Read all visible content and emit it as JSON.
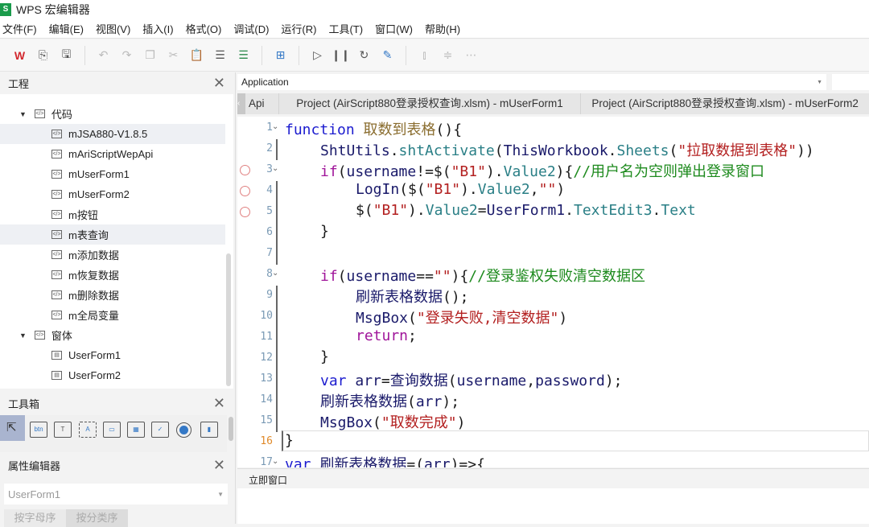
{
  "window": {
    "title": "WPS 宏编辑器",
    "logo": "S"
  },
  "menu": [
    "文件(F)",
    "编辑(E)",
    "视图(V)",
    "插入(I)",
    "格式(O)",
    "调试(D)",
    "运行(R)",
    "工具(T)",
    "窗口(W)",
    "帮助(H)"
  ],
  "project": {
    "title": "工程",
    "nodes": [
      {
        "label": "代码",
        "level": 0,
        "type": "folder",
        "expanded": true
      },
      {
        "label": "mJSA880-V1.8.5",
        "level": 1,
        "type": "module",
        "selected": true
      },
      {
        "label": "mAriScriptWepApi",
        "level": 1,
        "type": "module"
      },
      {
        "label": "mUserForm1",
        "level": 1,
        "type": "module"
      },
      {
        "label": "mUserForm2",
        "level": 1,
        "type": "module"
      },
      {
        "label": "m按钮",
        "level": 1,
        "type": "module"
      },
      {
        "label": "m表查询",
        "level": 1,
        "type": "module",
        "selected": true
      },
      {
        "label": "m添加数据",
        "level": 1,
        "type": "module"
      },
      {
        "label": "m恢复数据",
        "level": 1,
        "type": "module"
      },
      {
        "label": "m删除数据",
        "level": 1,
        "type": "module"
      },
      {
        "label": "m全局变量",
        "level": 1,
        "type": "module"
      },
      {
        "label": "窗体",
        "level": 0,
        "type": "folder",
        "expanded": true
      },
      {
        "label": "UserForm1",
        "level": 1,
        "type": "form"
      },
      {
        "label": "UserForm2",
        "level": 1,
        "type": "form"
      }
    ]
  },
  "toolbox": {
    "title": "工具箱"
  },
  "properties": {
    "title": "属性编辑器",
    "object": "UserForm1",
    "tabs": [
      "按字母序",
      "按分类序"
    ]
  },
  "editor": {
    "object_select": "Application",
    "tabs": [
      "Api",
      "Project (AirScript880登录授权查询.xlsm) - mUserForm1",
      "Project (AirScript880登录授权查询.xlsm) - mUserForm2"
    ],
    "current_line": 16,
    "lines": [
      {
        "n": "1",
        "ind": 0,
        "fold": true,
        "t": [
          [
            "kw",
            "function "
          ],
          [
            "fn",
            "取数到表格"
          ],
          [
            "",
            "(){"
          ]
        ]
      },
      {
        "n": "2",
        "ind": 1,
        "t": [
          [
            "id",
            "ShtUtils"
          ],
          [
            "",
            "."
          ],
          [
            "mem",
            "shtActivate"
          ],
          [
            "",
            "("
          ],
          [
            "id",
            "ThisWorkbook"
          ],
          [
            "",
            "."
          ],
          [
            "mem",
            "Sheets"
          ],
          [
            "",
            "("
          ],
          [
            "str",
            "\"拉取数据到表格\""
          ],
          [
            "",
            "))"
          ]
        ]
      },
      {
        "n": "3",
        "ind": 1,
        "bp": true,
        "fold": true,
        "t": [
          [
            "kw2",
            "if"
          ],
          [
            "",
            "("
          ],
          [
            "id",
            "username"
          ],
          [
            "",
            "!=$("
          ],
          [
            "str",
            "\"B1\""
          ],
          [
            "",
            ")."
          ],
          [
            "mem",
            "Value2"
          ],
          [
            "",
            "){"
          ],
          [
            "cm",
            "//用户名为空则弹出登录窗口"
          ]
        ]
      },
      {
        "n": "4",
        "ind": 2,
        "bp": true,
        "t": [
          [
            "id",
            "LogIn"
          ],
          [
            "",
            "($("
          ],
          [
            "str",
            "\"B1\""
          ],
          [
            "",
            ")."
          ],
          [
            "mem",
            "Value2"
          ],
          [
            "",
            ","
          ],
          [
            "str",
            "\"\""
          ],
          [
            "",
            ")"
          ]
        ]
      },
      {
        "n": "5",
        "ind": 2,
        "bp": true,
        "t": [
          [
            "",
            "$("
          ],
          [
            "str",
            "\"B1\""
          ],
          [
            "",
            ")."
          ],
          [
            "mem",
            "Value2"
          ],
          [
            "",
            "="
          ],
          [
            "id",
            "UserForm1"
          ],
          [
            "",
            "."
          ],
          [
            "mem",
            "TextEdit3"
          ],
          [
            "",
            "."
          ],
          [
            "mem",
            "Text"
          ]
        ]
      },
      {
        "n": "6",
        "ind": 1,
        "t": [
          [
            "",
            "}"
          ]
        ]
      },
      {
        "n": "7",
        "ind": 0,
        "t": []
      },
      {
        "n": "8",
        "ind": 1,
        "fold": true,
        "t": [
          [
            "kw2",
            "if"
          ],
          [
            "",
            "("
          ],
          [
            "id",
            "username"
          ],
          [
            "",
            "=="
          ],
          [
            "str",
            "\"\""
          ],
          [
            "",
            "){"
          ],
          [
            "cm",
            "//登录鉴权失败清空数据区"
          ]
        ]
      },
      {
        "n": "9",
        "ind": 2,
        "t": [
          [
            "id",
            "刷新表格数据"
          ],
          [
            "",
            "();"
          ]
        ]
      },
      {
        "n": "10",
        "ind": 2,
        "t": [
          [
            "id",
            "MsgBox"
          ],
          [
            "",
            "("
          ],
          [
            "str",
            "\"登录失败,清空数据\""
          ],
          [
            "",
            ")"
          ]
        ]
      },
      {
        "n": "11",
        "ind": 2,
        "t": [
          [
            "kw2",
            "return"
          ],
          [
            "",
            ";"
          ]
        ]
      },
      {
        "n": "12",
        "ind": 1,
        "t": [
          [
            "",
            "}"
          ]
        ]
      },
      {
        "n": "13",
        "ind": 1,
        "t": [
          [
            "kw",
            "var "
          ],
          [
            "id",
            "arr"
          ],
          [
            "",
            "="
          ],
          [
            "id",
            "查询数据"
          ],
          [
            "",
            "("
          ],
          [
            "id",
            "username"
          ],
          [
            "",
            ","
          ],
          [
            "id",
            "password"
          ],
          [
            "",
            ");"
          ]
        ]
      },
      {
        "n": "14",
        "ind": 1,
        "t": [
          [
            "id",
            "刷新表格数据"
          ],
          [
            "",
            "("
          ],
          [
            "id",
            "arr"
          ],
          [
            "",
            ");"
          ]
        ]
      },
      {
        "n": "15",
        "ind": 1,
        "t": [
          [
            "id",
            "MsgBox"
          ],
          [
            "",
            "("
          ],
          [
            "str",
            "\"取数完成\""
          ],
          [
            "",
            ")"
          ]
        ]
      },
      {
        "n": "16",
        "ind": 0,
        "t": [
          [
            "",
            "}"
          ]
        ]
      },
      {
        "n": "17",
        "ind": 0,
        "fold": true,
        "t": [
          [
            "kw",
            "var "
          ],
          [
            "id",
            "刷新表格数据"
          ],
          [
            "",
            "=("
          ],
          [
            "id",
            "arr"
          ],
          [
            "",
            ")=>{"
          ]
        ]
      }
    ]
  },
  "immediate": {
    "title": "立即窗口"
  }
}
